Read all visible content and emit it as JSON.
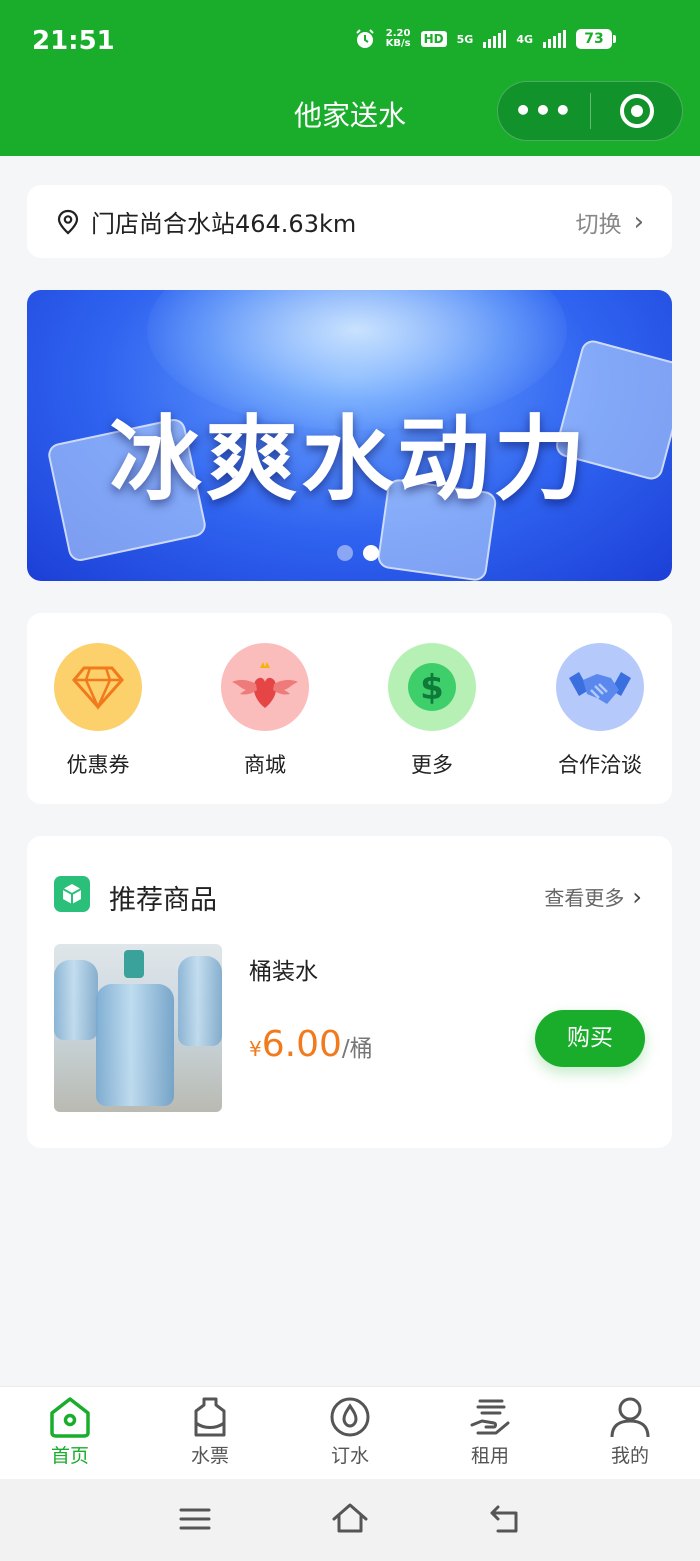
{
  "status_bar": {
    "time": "21:51",
    "net_speed_top": "2.20",
    "net_speed_bottom": "KB/s",
    "hd_label": "HD",
    "net_5g": "5G",
    "net_4g": "4G",
    "battery": "73"
  },
  "nav": {
    "title": "他家送水",
    "more_icon": "ellipsis-icon",
    "close_icon": "target-icon"
  },
  "store": {
    "name": "门店尚合水站464.63km",
    "switch_label": "切换",
    "icon": "location-pin-icon"
  },
  "banner": {
    "text": "冰爽水动力",
    "slide_count": 2,
    "active_slide": 1
  },
  "features": [
    {
      "label": "优惠券",
      "icon": "diamond-icon",
      "color": "#fcd06a"
    },
    {
      "label": "商城",
      "icon": "winged-heart-icon",
      "color": "#fbbcbc"
    },
    {
      "label": "更多",
      "icon": "dollar-icon",
      "color": "#b6f0b4"
    },
    {
      "label": "合作洽谈",
      "icon": "handshake-icon",
      "color": "#b5c9fb"
    }
  ],
  "recommend": {
    "title": "推荐商品",
    "more_label": "查看更多",
    "product": {
      "name": "桶装水",
      "currency": "¥",
      "price": "6.00",
      "unit": "/桶",
      "buy_label": "购买"
    }
  },
  "tabs": [
    {
      "label": "首页",
      "icon": "home-icon",
      "active": true
    },
    {
      "label": "水票",
      "icon": "water-bucket-icon",
      "active": false
    },
    {
      "label": "订水",
      "icon": "water-drop-icon",
      "active": false
    },
    {
      "label": "租用",
      "icon": "hand-rent-icon",
      "active": false
    },
    {
      "label": "我的",
      "icon": "user-icon",
      "active": false
    }
  ],
  "colors": {
    "brand_green": "#1aad2c",
    "price_orange": "#f07a1c"
  }
}
